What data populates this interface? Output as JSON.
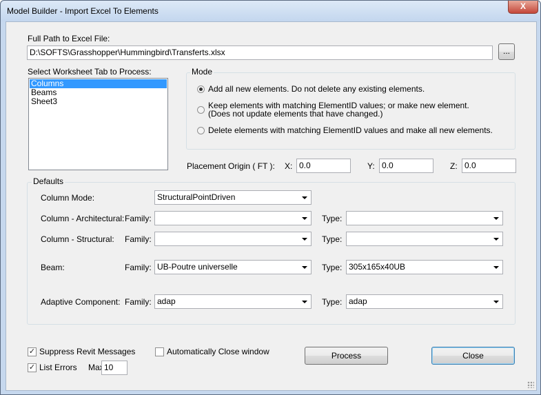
{
  "window": {
    "title": "Model Builder - Import Excel To Elements",
    "close_glyph": "X"
  },
  "file": {
    "label": "Full Path to Excel File:",
    "path": "D:\\SOFTS\\Grasshopper\\Hummingbird\\Transferts.xlsx",
    "browse_label": "..."
  },
  "worksheet": {
    "label": "Select Worksheet Tab to Process:",
    "items": [
      "Columns",
      "Beams",
      "Sheet3"
    ],
    "selected_index": 0
  },
  "mode": {
    "label": "Mode",
    "options": [
      {
        "line1": "Add all new elements.  Do not delete any existing elements.",
        "line2": "",
        "selected": true
      },
      {
        "line1": "Keep elements with matching ElementID  values; or make new element.",
        "line2": "(Does not update elements that have changed.)",
        "selected": false
      },
      {
        "line1": "Delete elements with matching ElementID values and make all new elements.",
        "line2": "",
        "selected": false
      }
    ]
  },
  "placement": {
    "label": "Placement Origin  ( FT ):",
    "x_label": "X:",
    "x": "0.0",
    "y_label": "Y:",
    "y": "0.0",
    "z_label": "Z:",
    "z": "0.0"
  },
  "defaults": {
    "label": "Defaults",
    "column_mode": {
      "label": "Column Mode:",
      "value": "StructuralPointDriven"
    },
    "family_label": "Family:",
    "type_label": "Type:",
    "rows": [
      {
        "label": "Column - Architectural:",
        "family": "",
        "type": ""
      },
      {
        "label": "Column - Structural:",
        "family": "",
        "type": ""
      },
      {
        "label": "Beam:",
        "family": "UB-Poutre universelle",
        "type": "305x165x40UB"
      },
      {
        "label": "Adaptive Component:",
        "family": "adap",
        "type": "adap"
      }
    ]
  },
  "options": {
    "suppress": {
      "label": "Suppress Revit Messages",
      "checked": true
    },
    "list_errors": {
      "label": "List Errors",
      "checked": true
    },
    "max_label": "Max:",
    "max_value": "10",
    "auto_close": {
      "label": "Automatically Close window",
      "checked": false
    }
  },
  "buttons": {
    "process": "Process",
    "close": "Close"
  }
}
